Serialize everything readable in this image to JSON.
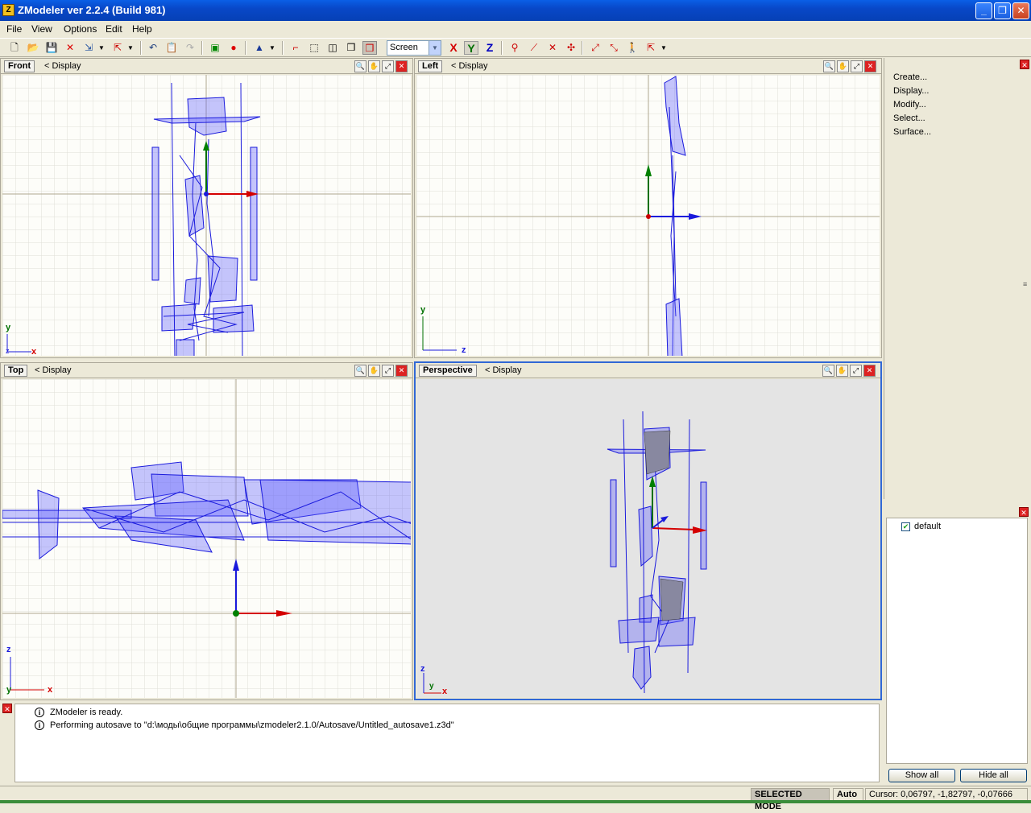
{
  "window": {
    "title": "ZModeler ver 2.2.4 (Build 981)",
    "icon": "Z"
  },
  "menu": {
    "items": [
      "File",
      "View",
      "Options",
      "Edit",
      "Help"
    ]
  },
  "toolbar": {
    "space_select": "Screen",
    "axes": {
      "x": "X",
      "y": "Y",
      "z": "Z"
    },
    "colors": {
      "x": "#d40000",
      "y": "#007000",
      "z": "#0000c0"
    }
  },
  "viewports": {
    "front": {
      "name": "Front",
      "display": "<  Display",
      "axis_v": "y",
      "axis_h": "x",
      "axis_corner": "z"
    },
    "left": {
      "name": "Left",
      "display": "<  Display",
      "axis_v": "y",
      "axis_h": "z"
    },
    "top": {
      "name": "Top",
      "display": "<  Display",
      "axis_v": "z",
      "axis_h": "x",
      "axis_corner": "y"
    },
    "perspective": {
      "name": "Perspective",
      "display": "<  Display",
      "axis_v": "z",
      "axis_h": "x",
      "axis_corner": "y"
    }
  },
  "side_panel": {
    "commands": [
      "Create...",
      "Display...",
      "Modify...",
      "Select...",
      "Surface..."
    ]
  },
  "objects_panel": {
    "items": [
      {
        "name": "default",
        "checked": true
      }
    ],
    "show_all": "Show all",
    "hide_all": "Hide all"
  },
  "log": {
    "lines": [
      "ZModeler is ready.",
      "Performing autosave to \"d:\\моды\\общие программы\\zmodeler2.1.0/Autosave/Untitled_autosave1.z3d\""
    ],
    "info_glyph": "i"
  },
  "status": {
    "mode": "SELECTED MODE",
    "auto": "Auto",
    "cursor": "Cursor: 0,06797, -1,82797, -0,07666"
  },
  "colors": {
    "wire": "#1a1adc",
    "grid": "#e4e4e4",
    "accent": "#3168d5"
  }
}
